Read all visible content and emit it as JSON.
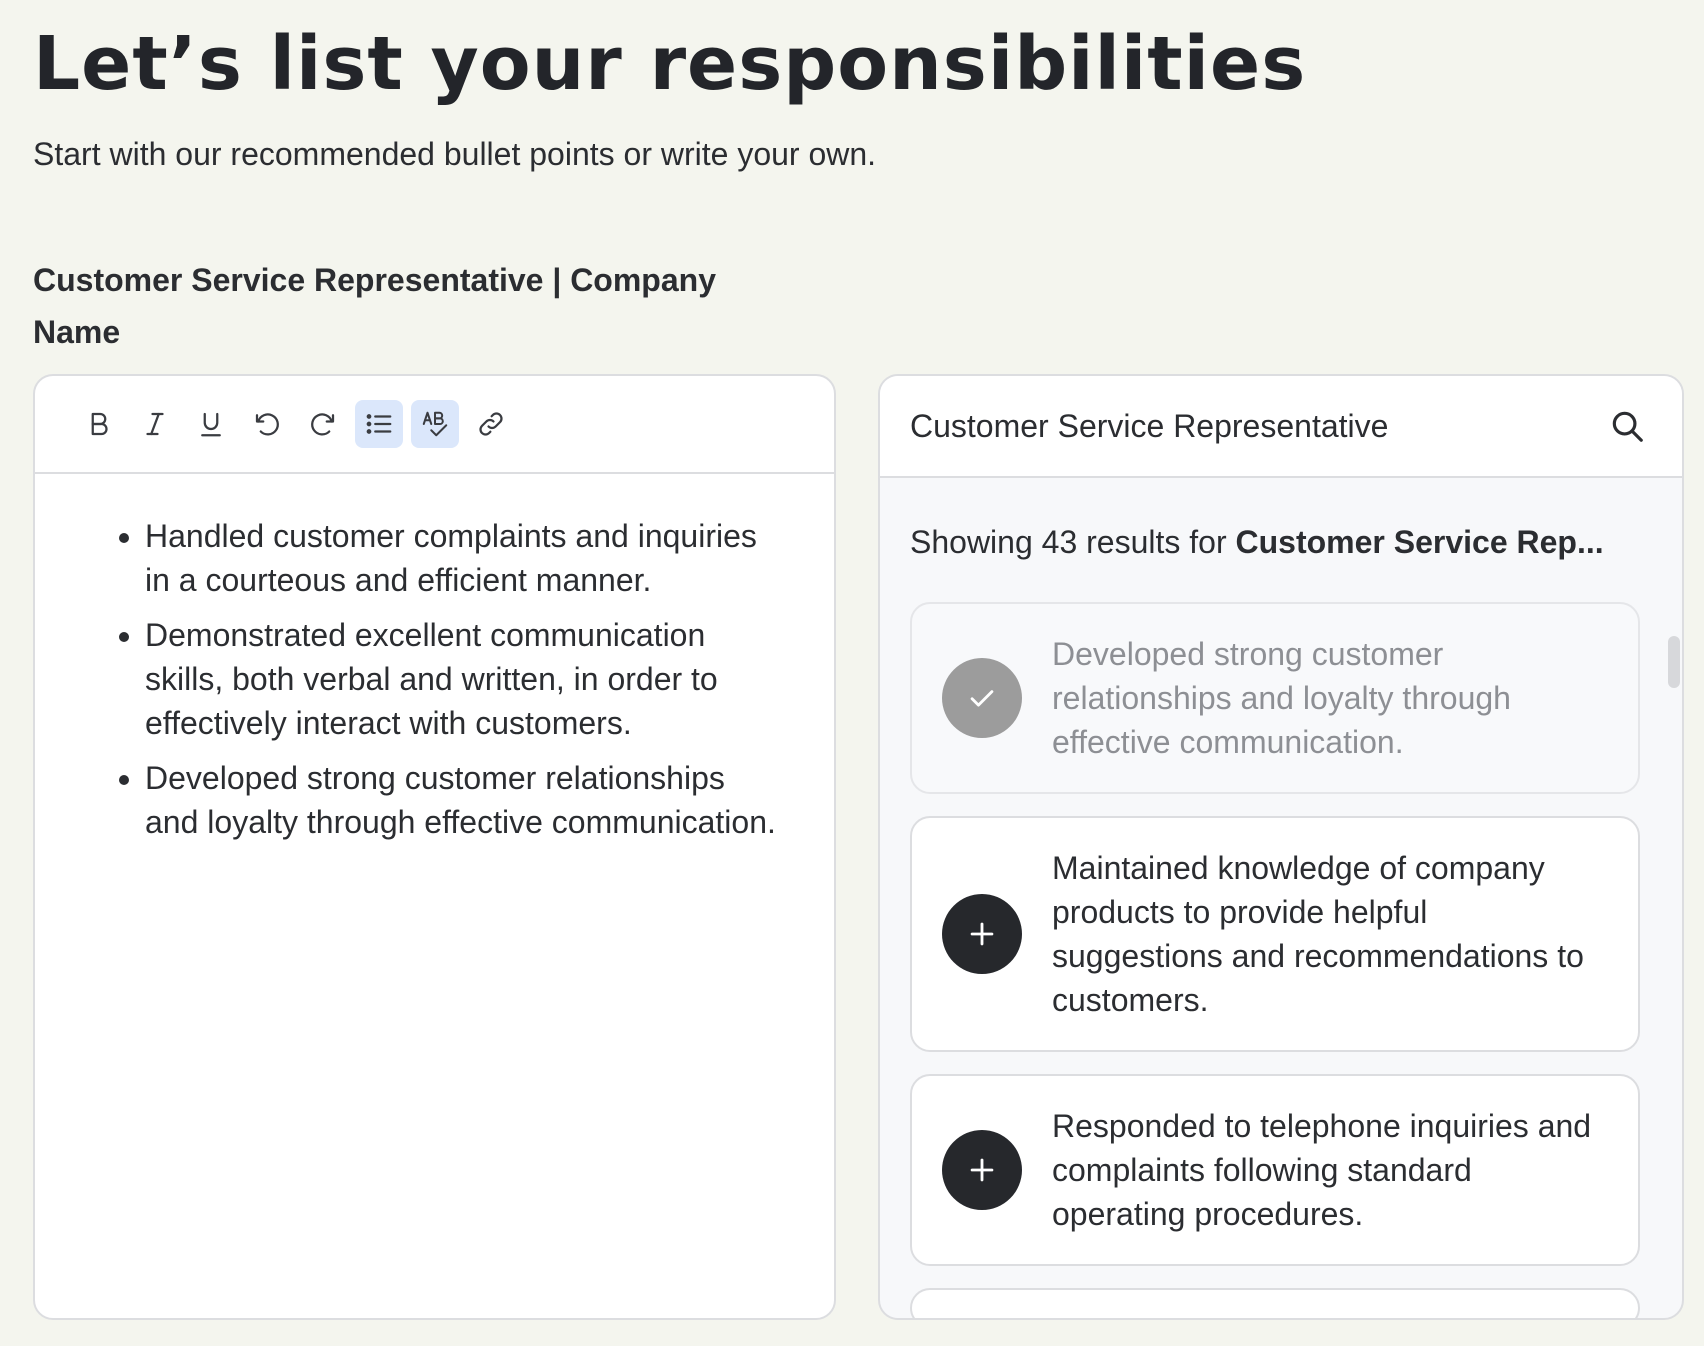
{
  "page": {
    "title": "Let’s list your responsibilities",
    "subtitle": "Start with our recommended bullet points or write your own.",
    "job_title": "Customer Service Representative | Company Name"
  },
  "toolbar": {
    "items": [
      {
        "name": "bold-icon",
        "active": false
      },
      {
        "name": "italic-icon",
        "active": false
      },
      {
        "name": "underline-icon",
        "active": false
      },
      {
        "name": "undo-icon",
        "active": false
      },
      {
        "name": "redo-icon",
        "active": false
      },
      {
        "name": "bullet-list-icon",
        "active": true
      },
      {
        "name": "spellcheck-icon",
        "active": true
      },
      {
        "name": "link-icon",
        "active": false
      }
    ],
    "active_color": "#dbe7fb"
  },
  "editor": {
    "bullets": [
      "Handled customer complaints and inquiries in a courteous and efficient manner.",
      "Demonstrated excellent communication skills, both verbal and written, in order to effectively interact with customers.",
      "Developed strong customer relationships and loyalty through effective communication."
    ]
  },
  "search": {
    "value": "Customer Service Representative",
    "icon": "search-icon"
  },
  "results": {
    "prefix": "Showing 43 results for ",
    "query": "Customer Service Rep..."
  },
  "suggestions": [
    {
      "text": "Developed strong customer relationships and loyalty through effective communication.",
      "added": true,
      "icon": "check-icon"
    },
    {
      "text": "Maintained knowledge of company products to provide helpful suggestions and recommendations to customers.",
      "added": false,
      "icon": "plus-icon"
    },
    {
      "text": "Responded to telephone inquiries and complaints following standard operating procedures.",
      "added": false,
      "icon": "plus-icon"
    }
  ],
  "colors": {
    "background": "#f4f5ee",
    "text": "#2b2d31",
    "add_button": "#26282c",
    "added_button": "#9c9c9c",
    "muted_text": "#8d8f94"
  }
}
